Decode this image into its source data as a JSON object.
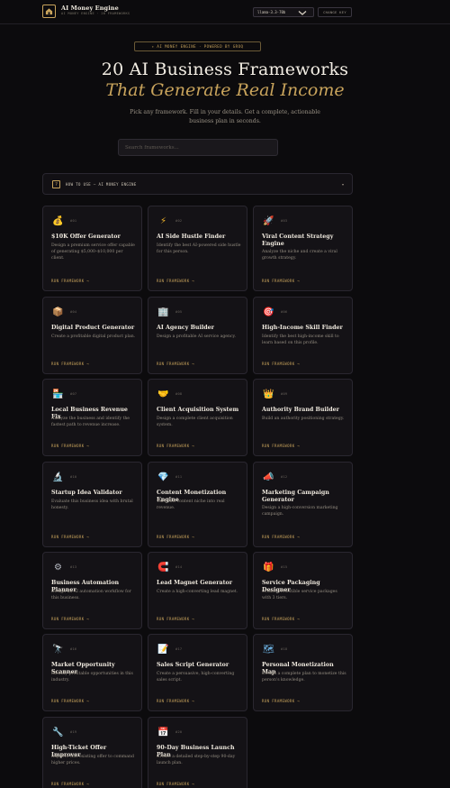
{
  "app": {
    "title": "AI Money Engine",
    "subtitle": "AI MONEY ENGINE · 20 FRAMEWORKS",
    "model": "llama-3.3-70b",
    "change_key": "CHANGE KEY"
  },
  "hero": {
    "badge": "✦ AI MONEY ENGINE · POWERED BY GROQ",
    "title_line1": "20 AI Business Frameworks",
    "title_line2": "That Generate Real Income",
    "subtitle": "Pick any framework. Fill in your details. Get a complete, actionable business plan in seconds.",
    "search_placeholder": "Search frameworks..."
  },
  "howto": {
    "icon": "?",
    "label": "HOW TO USE — AI MONEY ENGINE",
    "caret": "▾"
  },
  "run_label": "RUN FRAMEWORK →",
  "frameworks": [
    {
      "num": "#01",
      "icon": "money-bag-icon",
      "glyph": "💰",
      "color": "#e0a33a",
      "title": "$10K Offer Generator",
      "desc": "Design a premium service offer capable of generating $5,000–$10,000 per client."
    },
    {
      "num": "#02",
      "icon": "lightning-icon",
      "glyph": "⚡",
      "color": "#f0b429",
      "title": "AI Side Hustle Finder",
      "desc": "Identify the best AI-powered side hustle for this person."
    },
    {
      "num": "#03",
      "icon": "rocket-icon",
      "glyph": "🚀",
      "color": "#d9534f",
      "title": "Viral Content Strategy Engine",
      "desc": "Analyze the niche and create a viral growth strategy."
    },
    {
      "num": "#04",
      "icon": "package-icon",
      "glyph": "📦",
      "color": "#c28a4a",
      "title": "Digital Product Generator",
      "desc": "Create a profitable digital product plan."
    },
    {
      "num": "#05",
      "icon": "office-building-icon",
      "glyph": "🏢",
      "color": "#7aa7d9",
      "title": "AI Agency Builder",
      "desc": "Design a profitable AI service agency."
    },
    {
      "num": "#06",
      "icon": "target-icon",
      "glyph": "🎯",
      "color": "#e04b4b",
      "title": "High-Income Skill Finder",
      "desc": "Identify the best high-income skill to learn based on this profile."
    },
    {
      "num": "#07",
      "icon": "store-icon",
      "glyph": "🏪",
      "color": "#e06a8a",
      "title": "Local Business Revenue Fix",
      "desc": "Analyze the business and identify the fastest path to revenue increase."
    },
    {
      "num": "#08",
      "icon": "handshake-icon",
      "glyph": "🤝",
      "color": "#e0a33a",
      "title": "Client Acquisition System",
      "desc": "Design a complete client acquisition system."
    },
    {
      "num": "#09",
      "icon": "crown-icon",
      "glyph": "👑",
      "color": "#f0c040",
      "title": "Authority Brand Builder",
      "desc": "Build an authority positioning strategy."
    },
    {
      "num": "#10",
      "icon": "microscope-icon",
      "glyph": "🔬",
      "color": "#b8bcc4",
      "title": "Startup Idea Validator",
      "desc": "Evaluate this business idea with brutal honesty."
    },
    {
      "num": "#11",
      "icon": "diamond-icon",
      "glyph": "💎",
      "color": "#6cc3f0",
      "title": "Content Monetization Engine",
      "desc": "Turn this content niche into real revenue."
    },
    {
      "num": "#12",
      "icon": "megaphone-icon",
      "glyph": "📣",
      "color": "#e0a33a",
      "title": "Marketing Campaign Generator",
      "desc": "Design a high-conversion marketing campaign."
    },
    {
      "num": "#13",
      "icon": "gear-icon",
      "glyph": "⚙",
      "color": "#b8bcc4",
      "title": "Business Automation Planner",
      "desc": "Design an AI automation workflow for this business."
    },
    {
      "num": "#14",
      "icon": "magnet-icon",
      "glyph": "🧲",
      "color": "#e0475a",
      "title": "Lead Magnet Generator",
      "desc": "Create a high-converting lead magnet."
    },
    {
      "num": "#15",
      "icon": "gift-icon",
      "glyph": "🎁",
      "color": "#e0475a",
      "title": "Service Packaging Designer",
      "desc": "Create irresistible service packages with 3 tiers."
    },
    {
      "num": "#16",
      "icon": "telescope-icon",
      "glyph": "🔭",
      "color": "#b8bcc4",
      "title": "Market Opportunity Scanner",
      "desc": "Identify profitable opportunities in this industry."
    },
    {
      "num": "#17",
      "icon": "script-icon",
      "glyph": "📝",
      "color": "#e0c9a0",
      "title": "Sales Script Generator",
      "desc": "Create a persuasive, high-converting sales script."
    },
    {
      "num": "#18",
      "icon": "map-icon",
      "glyph": "🗺",
      "color": "#6cb0e0",
      "title": "Personal Monetization Map",
      "desc": "Design a complete plan to monetize this person's knowledge."
    },
    {
      "num": "#19",
      "icon": "wrench-icon",
      "glyph": "🔧",
      "color": "#b8bcc4",
      "title": "High-Ticket Offer Improver",
      "desc": "Improve this existing offer to command higher prices."
    },
    {
      "num": "#20",
      "icon": "calendar-icon",
      "glyph": "📅",
      "color": "#7aa7d9",
      "title": "90-Day Business Launch Plan",
      "desc": "Create a detailed step-by-step 90-day launch plan."
    }
  ]
}
